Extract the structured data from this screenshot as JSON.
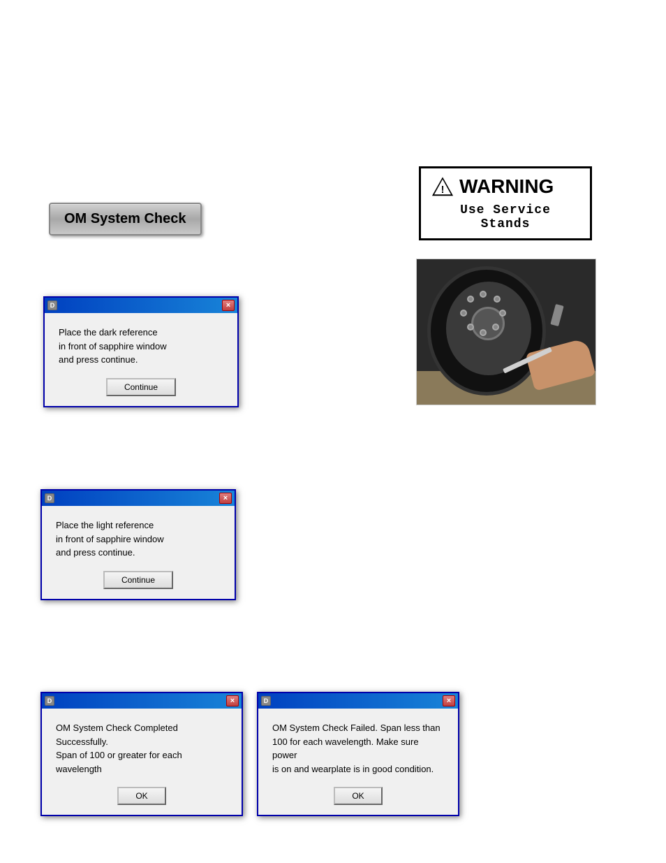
{
  "om_button": {
    "label": "OM System Check"
  },
  "warning": {
    "title": "WARNING",
    "subtitle": "Use Service Stands"
  },
  "dialog1": {
    "title_icon": "D",
    "close": "×",
    "message": "Place the dark reference\nin front of sapphire window\nand press continue.",
    "button": "Continue"
  },
  "dialog2": {
    "title_icon": "D",
    "close": "×",
    "message": "Place the light reference\nin front of sapphire window\nand press continue.",
    "button": "Continue"
  },
  "dialog3": {
    "title_icon": "D",
    "close": "×",
    "message": "OM System Check Completed Successfully.\nSpan of 100 or greater for each wavelength",
    "button": "OK"
  },
  "dialog4": {
    "title_icon": "D",
    "close": "×",
    "message": "OM System Check Failed.  Span less than\n100 for each wavelength.  Make sure power\nis on and wearplate is in good condition.",
    "button": "OK"
  }
}
